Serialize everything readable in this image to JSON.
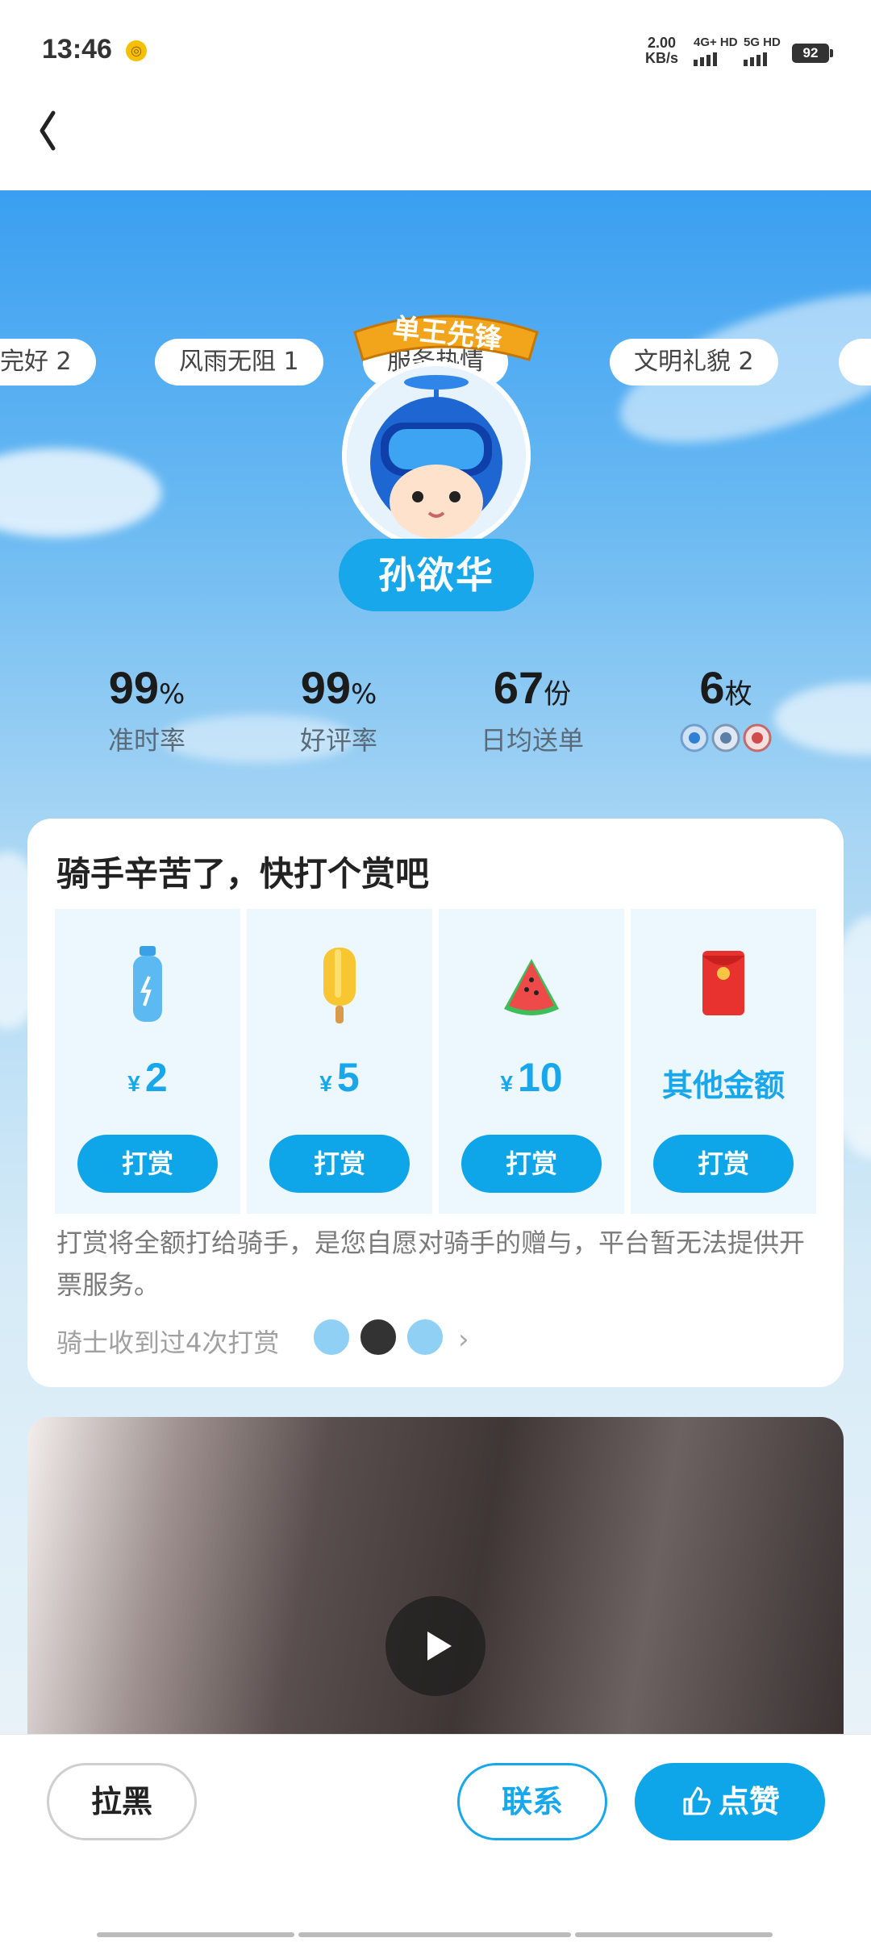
{
  "status_bar": {
    "time": "13:46",
    "net_speed_value": "2.00",
    "net_speed_unit": "KB/s",
    "signal_1": "4G+ HD",
    "signal_2": "5G HD",
    "battery": "92"
  },
  "tags": [
    "完好 2",
    "风雨无阻 1",
    "服务热情",
    "文明礼貌 2"
  ],
  "badge": {
    "title": "单王先锋"
  },
  "rider": {
    "name": "孙欲华"
  },
  "stats": [
    {
      "value": "99",
      "unit": "%",
      "label": "准时率"
    },
    {
      "value": "99",
      "unit": "%",
      "label": "好评率"
    },
    {
      "value": "67",
      "unit": "份",
      "label": "日均送单"
    },
    {
      "value": "6",
      "unit": "枚"
    }
  ],
  "tip": {
    "title": "骑手辛苦了，快打个赏吧",
    "currency": "¥",
    "options": [
      {
        "amount": "2",
        "icon": "water-bottle-icon",
        "button": "打赏"
      },
      {
        "amount": "5",
        "icon": "popsicle-icon",
        "button": "打赏"
      },
      {
        "amount": "10",
        "icon": "watermelon-icon",
        "button": "打赏"
      },
      {
        "amount": "其他金额",
        "icon": "red-envelope-icon",
        "button": "打赏"
      }
    ],
    "note": "打赏将全额打给骑手，是您自愿对骑手的赠与，平台暂无法提供开票服务。",
    "received": "骑士收到过4次打赏"
  },
  "bottom": {
    "block": "拉黑",
    "contact": "联系",
    "like": "点赞"
  },
  "colors": {
    "accent": "#17a7ea",
    "tip_bg": "#edf7fe",
    "sky_top": "#3a9ff1"
  }
}
